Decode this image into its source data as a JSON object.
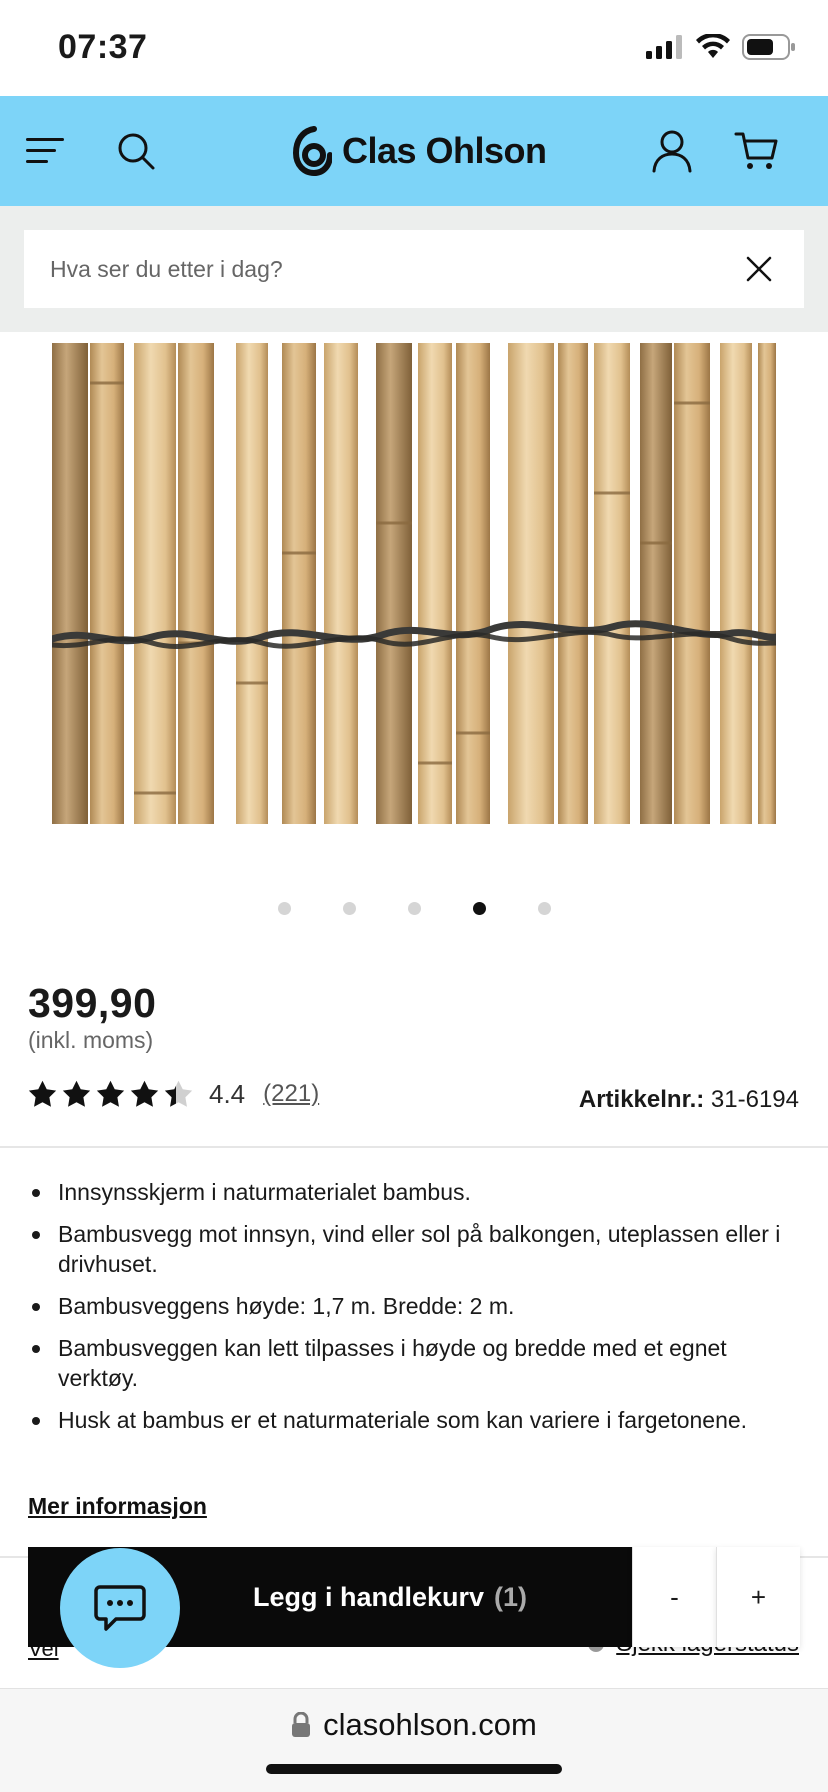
{
  "status": {
    "time": "07:37"
  },
  "header": {
    "brand": "Clas Ohlson",
    "menu_icon": "menu-icon",
    "search_icon": "search-icon",
    "account_icon": "user-icon",
    "cart_icon": "cart-icon",
    "background": "#7dd4f8"
  },
  "search": {
    "placeholder": "Hva ser du etter i dag?",
    "clear_icon": "close-icon"
  },
  "gallery": {
    "image_count": 5,
    "active_index": 3
  },
  "product": {
    "price": "399,90",
    "price_note": "(inkl. moms)",
    "rating_value": "4.4",
    "rating_stars": 4.4,
    "rating_count": "(221)",
    "article_label": "Artikkelnr.:",
    "article_number": "31-6194",
    "features": [
      "Innsynsskjerm i naturmaterialet bambus.",
      "Bambusvegg mot innsyn, vind eller sol på balkongen, uteplassen eller i drivhuset.",
      "Bambusveggens høyde: 1,7 m. Bredde: 2 m.",
      "Bambusveggen kan lett tilpasses i høyde og bredde med et egnet verktøy.",
      "Husk at bambus er et naturmateriale som kan variere i fargetonene."
    ],
    "more_info": "Mer informasjon"
  },
  "partially_hidden": {
    "left_link": "Vel",
    "right_link": "Sjekk lagerstatus"
  },
  "cart": {
    "add_label": "Legg i handlekurv",
    "count": "(1)",
    "minus": "-",
    "plus": "+"
  },
  "chat": {
    "icon": "chat-icon",
    "color": "#7dd4f8"
  },
  "browser": {
    "url": "clasohlson.com",
    "lock_icon": "lock-icon"
  }
}
